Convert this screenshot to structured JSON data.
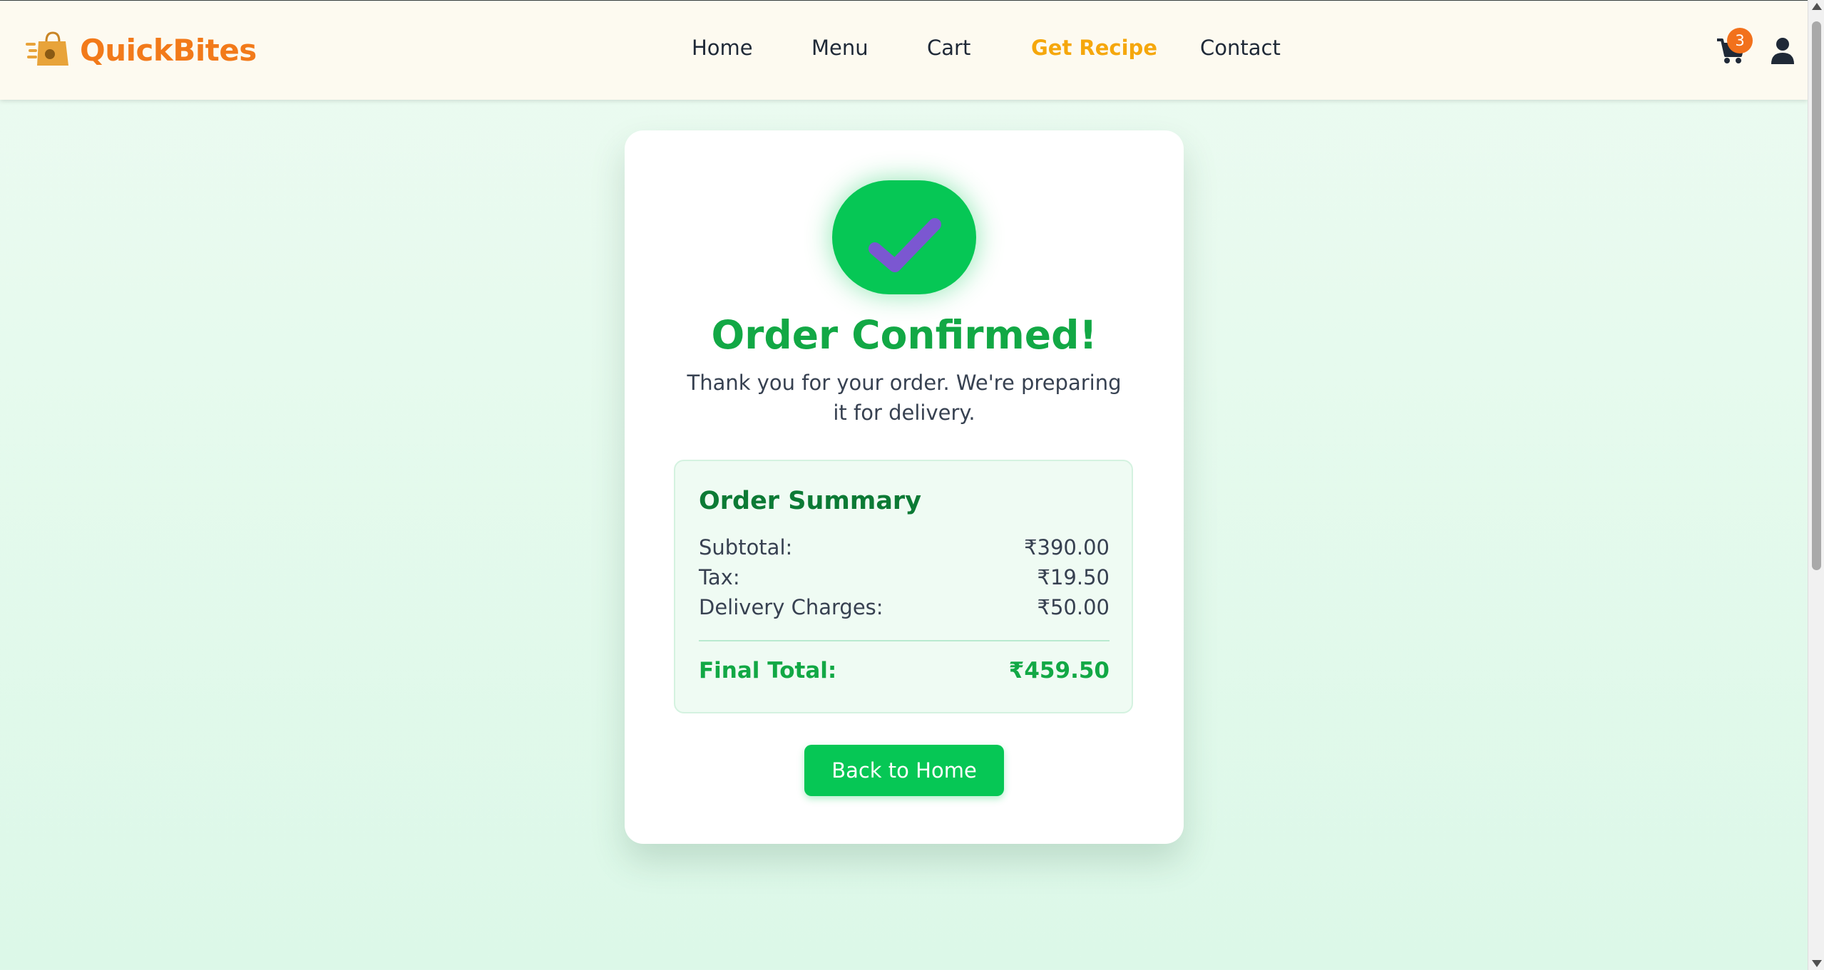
{
  "brand": {
    "name": "QuickBites",
    "color": "#f27a1a"
  },
  "nav": {
    "items": [
      {
        "label": "Home"
      },
      {
        "label": "Menu"
      },
      {
        "label": "Cart"
      },
      {
        "label": "Get Recipe",
        "active": true
      },
      {
        "label": "Contact"
      }
    ]
  },
  "header_actions": {
    "cart_icon": "shopping-cart-icon",
    "cart_count": "3",
    "user_icon": "user-icon"
  },
  "confirmation": {
    "icon": "checkmark-icon",
    "title": "Order Confirmed!",
    "message": "Thank you for your order. We're preparing it for delivery."
  },
  "summary": {
    "title": "Order Summary",
    "rows": [
      {
        "label": "Subtotal:",
        "value": "₹390.00"
      },
      {
        "label": "Tax:",
        "value": "₹19.50"
      },
      {
        "label": "Delivery Charges:",
        "value": "₹50.00"
      }
    ],
    "final": {
      "label": "Final Total:",
      "value": "₹459.50"
    }
  },
  "actions": {
    "back_home_label": "Back to Home"
  },
  "colors": {
    "accent_green": "#06c755",
    "nav_active": "#f5a70c",
    "badge": "#f2711c"
  }
}
